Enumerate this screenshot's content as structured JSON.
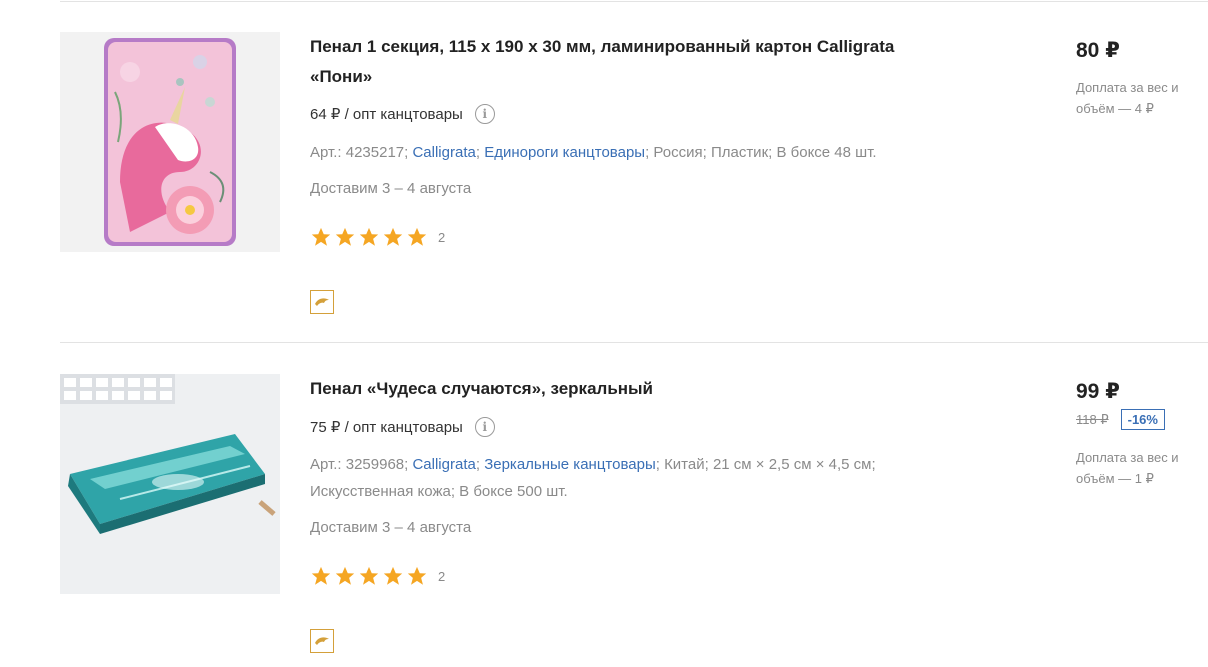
{
  "products": [
    {
      "title": "Пенал 1 секция, 115 х 190 х 30 мм, ламинированный картон Calligrata «Пони»",
      "opt_price": "64 ₽ / опт канцтовары",
      "meta": {
        "article": "Арт.: 4235217;",
        "brand": "Calligrata",
        "sep1": ";",
        "collection": "Единороги канцтовары",
        "rest": "; Россия; Пластик; В боксе 48 шт."
      },
      "delivery": "Доставим 3 – 4 августа",
      "rating_count": "2",
      "price": "80 ₽",
      "surcharge": "Доплата за вес и объём — 4 ₽"
    },
    {
      "title": "Пенал «Чудеса случаются», зеркальный",
      "opt_price": "75 ₽ / опт канцтовары",
      "meta": {
        "article": "Арт.: 3259968;",
        "brand": "Calligrata",
        "sep1": ";",
        "collection": "Зеркальные канцтовары",
        "rest": "; Китай; 21 см × 2,5 см × 4,5 см; Искусственная кожа; В боксе 500 шт."
      },
      "delivery": "Доставим 3 – 4 августа",
      "rating_count": "2",
      "price": "99 ₽",
      "old_price": "118 ₽",
      "discount": "-16%",
      "surcharge": "Доплата за вес и объём — 1 ₽"
    }
  ],
  "icons": {
    "info": "info-icon",
    "star": "star-icon",
    "wholesale": "dolphin-icon"
  },
  "colors": {
    "link": "#3a6fb5",
    "star": "#f5a623",
    "badge_border": "#d4a03a"
  }
}
